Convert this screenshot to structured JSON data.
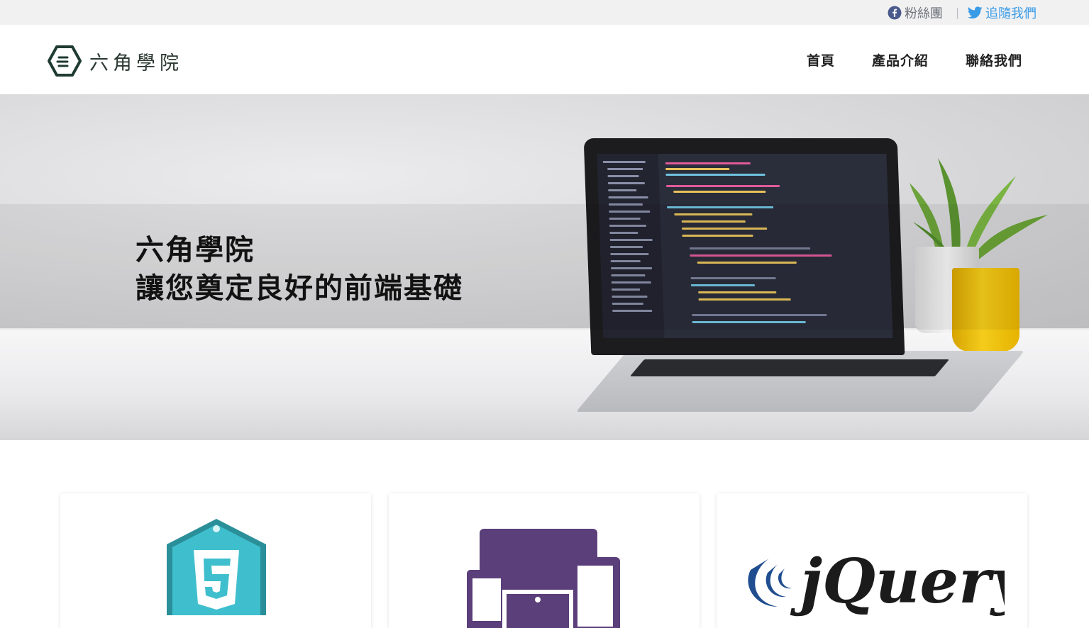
{
  "topbar": {
    "facebook_label": "粉絲團",
    "twitter_label": "追隨我們",
    "separator": "|"
  },
  "brand": {
    "name": "六角學院",
    "logo_icon": "hexagon-logo-icon"
  },
  "nav": {
    "items": [
      "首頁",
      "產品介紹",
      "聯絡我們"
    ]
  },
  "hero": {
    "line1": "六角學院",
    "line2": "讓您奠定良好的前端基礎"
  },
  "cards": [
    {
      "icon": "html5-badge-icon",
      "color": "#3fbfcd"
    },
    {
      "icon": "responsive-devices-icon",
      "color": "#5b3f7a"
    },
    {
      "icon": "jquery-logo-icon",
      "color": "#1b1b1b",
      "wordmark": "jQuery"
    }
  ],
  "colors": {
    "brand_dark": "#1f3b32",
    "twitter": "#3a9be6",
    "facebook": "#4a5a8c"
  }
}
